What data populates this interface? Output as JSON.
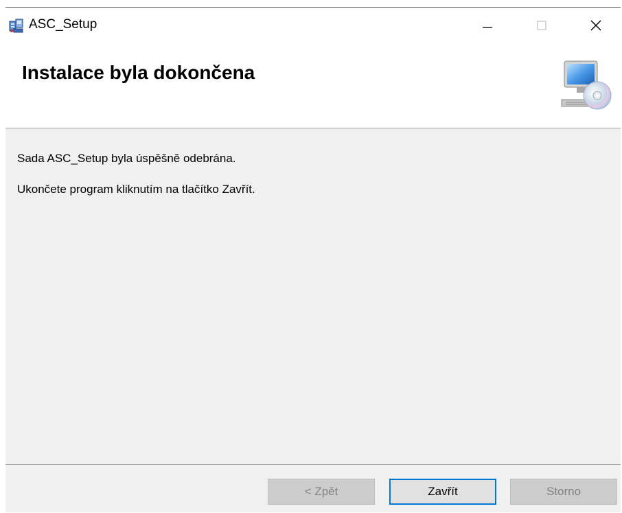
{
  "window": {
    "title": "ASC_Setup"
  },
  "banner": {
    "title": "Instalace byla dokončena",
    "icon": "computer-cd-icon"
  },
  "content": {
    "line1": "Sada ASC_Setup byla úspěšně odebrána.",
    "line2": "Ukončete program kliknutím na tlačítko Zavřít."
  },
  "footer": {
    "back_label": "< Zpět",
    "close_label": "Zavřít",
    "cancel_label": "Storno"
  },
  "colors": {
    "accent": "#0078d7",
    "panel": "#f0f0f0",
    "disabled_text": "#838383"
  }
}
